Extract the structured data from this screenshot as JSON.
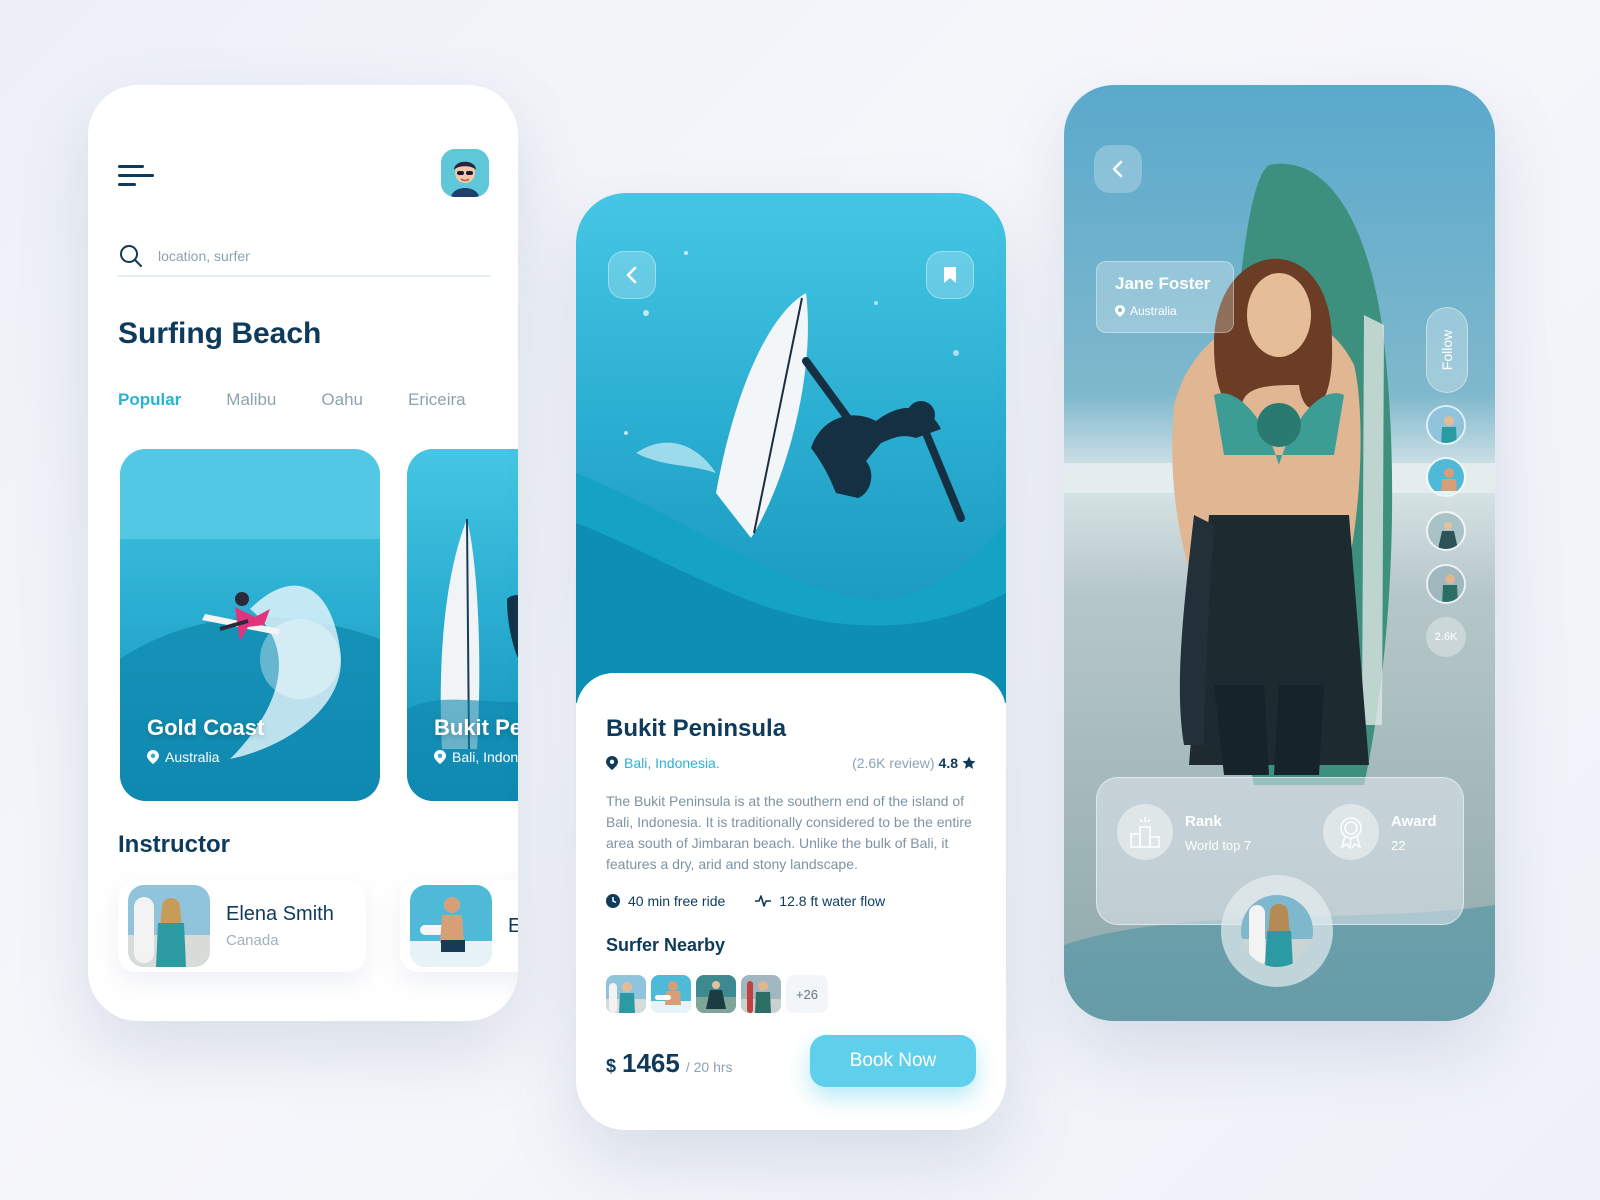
{
  "home": {
    "search_placeholder": "location, surfer",
    "section_title": "Surfing Beach",
    "tabs": [
      {
        "label": "Popular"
      },
      {
        "label": "Malibu"
      },
      {
        "label": "Oahu"
      },
      {
        "label": "Ericeira"
      }
    ],
    "cards": [
      {
        "name": "Gold Coast",
        "location": "Australia"
      },
      {
        "name": "Bukit Peninsula",
        "location": "Bali, Indonesia"
      }
    ],
    "instructor_title": "Instructor",
    "instructors": [
      {
        "name": "Elena Smith",
        "country": "Canada"
      },
      {
        "name": "E",
        "country": ""
      }
    ]
  },
  "detail": {
    "title": "Bukit Peninsula",
    "location": "Bali, Indonesia.",
    "reviews": "(2.6K review)",
    "rating": "4.8",
    "description": "The Bukit Peninsula is at the southern end of the island of Bali, Indonesia. It is traditionally considered to be the entire area south of Jimbaran beach. Unlike the bulk of Bali, it features a dry, arid and stony landscape.",
    "feature_ride": "40 min free ride",
    "feature_flow": "12.8 ft water flow",
    "nearby_title": "Surfer Nearby",
    "nearby_more": "+26",
    "currency": "$",
    "price": "1465",
    "duration": "/ 20 hrs",
    "book_label": "Book Now"
  },
  "profile": {
    "name": "Jane Foster",
    "location": "Australia",
    "follow_label": "Follow",
    "followers_count": "2.6K",
    "rank_title": "Rank",
    "rank_value": "World top 7",
    "award_title": "Award",
    "award_value": "22"
  },
  "colors": {
    "accent": "#2ab2d6",
    "button": "#5fd0ec",
    "navy": "#0e3a5b",
    "muted": "#8ba3b3"
  },
  "icons": [
    "menu-icon",
    "search-icon",
    "location-pin-icon",
    "star-icon",
    "clock-icon",
    "pulse-icon",
    "back-arrow-icon",
    "bookmark-icon",
    "rank-podium-icon",
    "award-ribbon-icon"
  ]
}
